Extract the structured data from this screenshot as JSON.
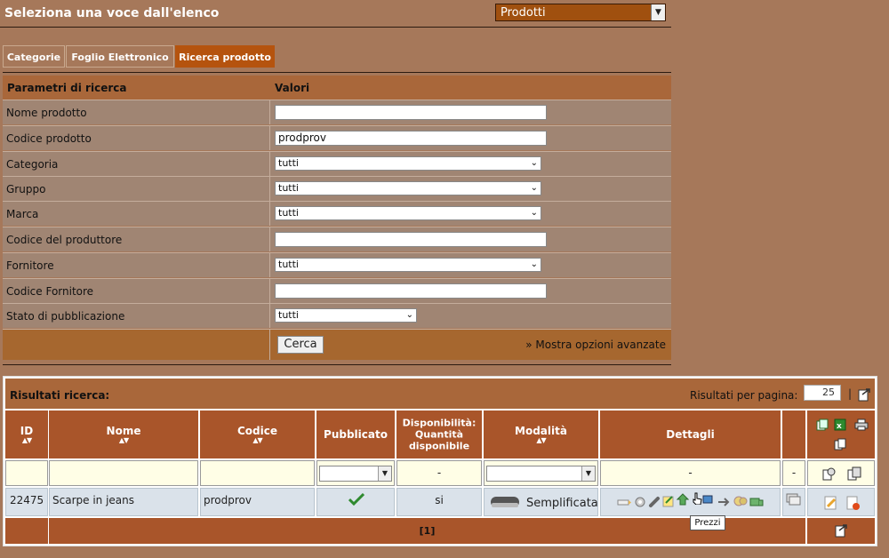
{
  "header": {
    "title": "Seleziona una voce dall'elenco",
    "selector_value": "Prodotti"
  },
  "tabs": [
    {
      "label": "Categorie"
    },
    {
      "label": "Foglio Elettronico"
    },
    {
      "label": "Ricerca prodotto"
    }
  ],
  "search_form": {
    "col_params": "Parametri di ricerca",
    "col_values": "Valori",
    "fields": [
      {
        "label": "Nome prodotto",
        "type": "text",
        "value": ""
      },
      {
        "label": "Codice prodotto",
        "type": "text",
        "value": "prodprov"
      },
      {
        "label": "Categoria",
        "type": "select",
        "value": "tutti"
      },
      {
        "label": "Gruppo",
        "type": "select",
        "value": "tutti"
      },
      {
        "label": "Marca",
        "type": "select",
        "value": "tutti"
      },
      {
        "label": "Codice del produttore",
        "type": "text",
        "value": ""
      },
      {
        "label": "Fornitore",
        "type": "select",
        "value": "tutti"
      },
      {
        "label": "Codice Fornitore",
        "type": "text",
        "value": ""
      },
      {
        "label": "Stato di pubblicazione",
        "type": "select",
        "value": "tutti"
      }
    ],
    "search_button": "Cerca",
    "advanced_link": "» Mostra opzioni avanzate"
  },
  "results": {
    "title": "Risultati ricerca:",
    "per_page_label": "Risultati per pagina:",
    "per_page_value": "25",
    "columns": {
      "id": "ID",
      "nome": "Nome",
      "codice": "Codice",
      "pubblicato": "Pubblicato",
      "disp1": "Disponibilità:",
      "disp2": "Quantità",
      "disp3": "disponibile",
      "modalita": "Modalità",
      "dettagli": "Dettagli"
    },
    "filters": {
      "disp": "-",
      "dettagli": "-",
      "extra": "-"
    },
    "row": {
      "id": "22475",
      "nome": "Scarpe in jeans",
      "codice": "prodprov",
      "disponibilita": "si",
      "modalita": "Semplificata"
    },
    "pagination": "[1]",
    "tooltip": "Prezzi"
  }
}
